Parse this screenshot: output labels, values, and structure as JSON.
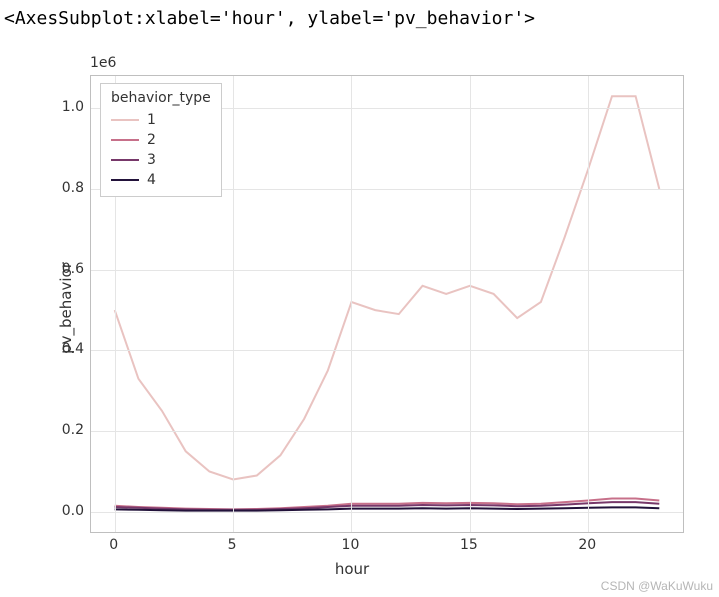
{
  "repr_text": "<AxesSubplot:xlabel='hour', ylabel='pv_behavior'>",
  "offset_text": "1e6",
  "xlabel": "hour",
  "ylabel": "pv_behavior",
  "xticks": [
    "0",
    "5",
    "10",
    "15",
    "20"
  ],
  "yticks": [
    "0.0",
    "0.2",
    "0.4",
    "0.6",
    "0.8",
    "1.0"
  ],
  "legend_title": "behavior_type",
  "legend_items": [
    "1",
    "2",
    "3",
    "4"
  ],
  "watermark": "CSDN @WaKuWuku",
  "chart_data": {
    "type": "line",
    "title": "",
    "xlabel": "hour",
    "ylabel": "pv_behavior",
    "xlim": [
      -1,
      24
    ],
    "ylim": [
      -0.05,
      1.08
    ],
    "y_scale_factor": 1000000,
    "x": [
      0,
      1,
      2,
      3,
      4,
      5,
      6,
      7,
      8,
      9,
      10,
      11,
      12,
      13,
      14,
      15,
      16,
      17,
      18,
      19,
      20,
      21,
      22,
      23
    ],
    "series": [
      {
        "name": "1",
        "color": "#e9c3c1",
        "values": [
          0.5,
          0.33,
          0.25,
          0.15,
          0.1,
          0.08,
          0.09,
          0.14,
          0.23,
          0.35,
          0.52,
          0.5,
          0.49,
          0.56,
          0.54,
          0.56,
          0.54,
          0.48,
          0.52,
          0.68,
          0.85,
          1.03,
          1.03,
          0.8
        ]
      },
      {
        "name": "2",
        "color": "#c7708a",
        "values": [
          0.015,
          0.012,
          0.01,
          0.008,
          0.007,
          0.006,
          0.007,
          0.009,
          0.012,
          0.015,
          0.02,
          0.02,
          0.02,
          0.022,
          0.021,
          0.022,
          0.021,
          0.019,
          0.02,
          0.024,
          0.028,
          0.033,
          0.033,
          0.028
        ]
      },
      {
        "name": "3",
        "color": "#77386a",
        "values": [
          0.012,
          0.01,
          0.008,
          0.006,
          0.005,
          0.005,
          0.005,
          0.007,
          0.009,
          0.012,
          0.015,
          0.015,
          0.015,
          0.017,
          0.016,
          0.017,
          0.016,
          0.014,
          0.015,
          0.018,
          0.021,
          0.024,
          0.024,
          0.02
        ]
      },
      {
        "name": "4",
        "color": "#22123a",
        "values": [
          0.006,
          0.005,
          0.004,
          0.003,
          0.003,
          0.003,
          0.003,
          0.004,
          0.005,
          0.006,
          0.008,
          0.008,
          0.008,
          0.009,
          0.008,
          0.009,
          0.008,
          0.007,
          0.008,
          0.009,
          0.01,
          0.011,
          0.011,
          0.009
        ]
      }
    ],
    "legend": {
      "title": "behavior_type",
      "position": "upper left"
    }
  }
}
